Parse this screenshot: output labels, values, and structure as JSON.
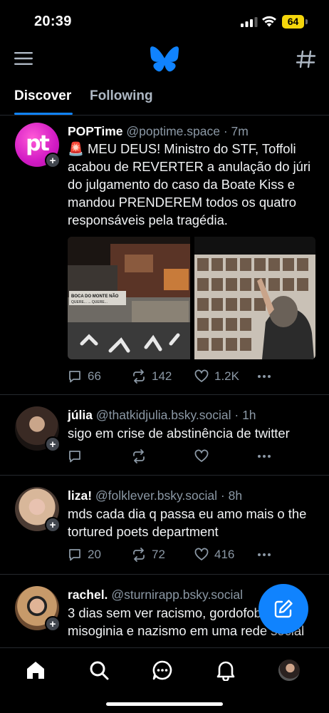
{
  "status_bar": {
    "time": "20:39",
    "battery": "64"
  },
  "colors": {
    "accent": "#1083fe",
    "background": "#000000",
    "muted": "#8b98a5",
    "battery": "#f5d60b"
  },
  "header": {
    "left_icon": "menu-icon",
    "logo": "butterfly-logo-icon",
    "right_icon": "hash-icon"
  },
  "tabs": [
    {
      "label": "Discover",
      "active": true
    },
    {
      "label": "Following",
      "active": false
    }
  ],
  "posts": [
    {
      "name": "POPTime",
      "handle": "@poptime.space",
      "time": "· 7m",
      "avatar_text": "pt",
      "text": "🚨 MEU DEUS! Ministro do STF, Toffoli acabou de REVERTER a anulação do júri do julgamento do caso da Boate Kiss e mandou PRENDEREM todos os quatro responsáveis pela tragédia.",
      "replies": "66",
      "reposts": "142",
      "likes": "1.2K",
      "images": {
        "left_sign": "BOCA DO MONTE NÃO\nQUERE... ... QUERE..."
      }
    },
    {
      "name": "júlia",
      "handle": "@thatkidjulia.bsky.social",
      "time": "· 1h",
      "text": "sigo em crise de abstinência de twitter",
      "replies": "",
      "reposts": "",
      "likes": ""
    },
    {
      "name": "liza!",
      "handle": "@folklever.bsky.social",
      "time": "· 8h",
      "text": "mds cada dia q passa eu amo mais o the tortured poets department",
      "replies": "20",
      "reposts": "72",
      "likes": "416"
    },
    {
      "name": "rachel.",
      "handle": "@sturnirapp.bsky.social",
      "time": "",
      "text": "3 dias sem ver racismo, gordofobia, misoginia e nazismo em uma rede social"
    }
  ],
  "fab": {
    "icon": "compose-icon"
  },
  "bottom_nav": [
    "home-icon",
    "search-icon",
    "chat-icon",
    "bell-icon",
    "profile-avatar"
  ]
}
